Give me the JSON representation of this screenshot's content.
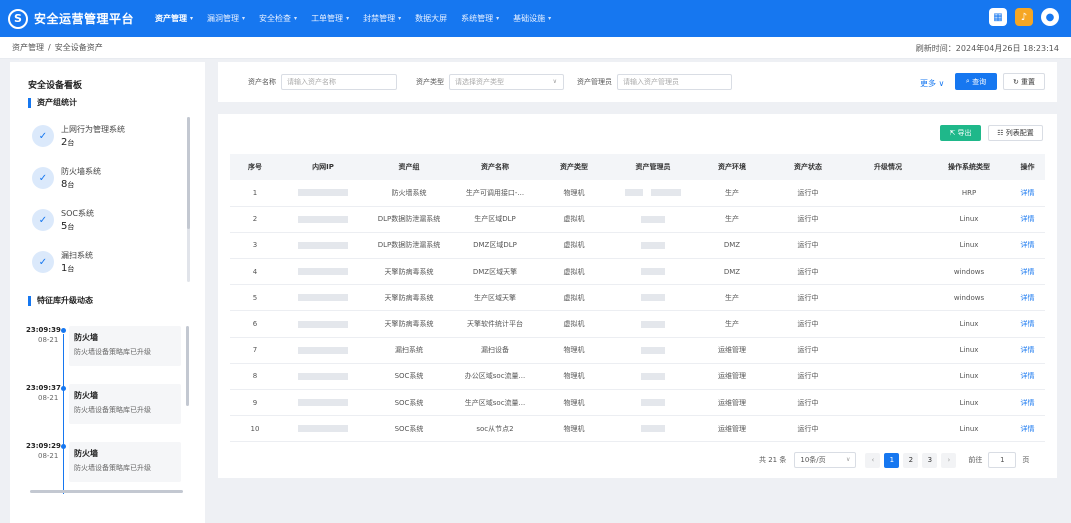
{
  "header": {
    "logo_glyph": "S",
    "title": "安全运营管理平台",
    "nav": [
      {
        "label": "资产管理",
        "caret": true,
        "active": true
      },
      {
        "label": "漏洞管理",
        "caret": true
      },
      {
        "label": "安全检查",
        "caret": true
      },
      {
        "label": "工单管理",
        "caret": true
      },
      {
        "label": "封禁管理",
        "caret": true
      },
      {
        "label": "数据大屏",
        "caret": false
      },
      {
        "label": "系统管理",
        "caret": true
      },
      {
        "label": "基础设施",
        "caret": true
      }
    ],
    "accent_color": "#1677f0"
  },
  "breadcrumb": {
    "items": [
      "资产管理",
      "安全设备资产"
    ],
    "separator": "/",
    "refresh_label": "刷新时间：",
    "refresh_time": "2024年04月26日 18:23:14"
  },
  "sidebar": {
    "title": "安全设备看板",
    "group_section": "资产组统计",
    "groups": [
      {
        "name": "上网行为管理系统",
        "count": "2",
        "unit": "台"
      },
      {
        "name": "防火墙系统",
        "count": "8",
        "unit": "台"
      },
      {
        "name": "SOC系统",
        "count": "5",
        "unit": "台"
      },
      {
        "name": "漏扫系统",
        "count": "1",
        "unit": "台"
      }
    ],
    "feed_section": "特征库升级动态",
    "feed": [
      {
        "time": "23:09:39",
        "date": "08-21",
        "title": "防火墙",
        "desc": "防火墙设备策略库已升级"
      },
      {
        "time": "23:09:37",
        "date": "08-21",
        "title": "防火墙",
        "desc": "防火墙设备策略库已升级"
      },
      {
        "time": "23:09:29",
        "date": "08-21",
        "title": "防火墙",
        "desc": "防火墙设备策略库已升级"
      }
    ]
  },
  "search": {
    "fields": [
      {
        "label": "资产名称",
        "placeholder": "请输入资产名称"
      },
      {
        "label": "资产类型",
        "placeholder": "请选择资产类型"
      },
      {
        "label": "资产管理员",
        "placeholder": "请输入资产管理员"
      }
    ],
    "more_label": "更多",
    "query_label": "查询",
    "reset_label": "重置"
  },
  "toolbar": {
    "export_label": "导出",
    "columns_label": "列表配置"
  },
  "table": {
    "columns": [
      "序号",
      "内网IP",
      "资产组",
      "资产名称",
      "资产类型",
      "资产管理员",
      "资产环境",
      "资产状态",
      "升级情况",
      "操作系统类型",
      "操作"
    ],
    "rows": [
      {
        "no": "1",
        "group": "防火墙系统",
        "name": "生产可调用接口-...",
        "type": "物理机",
        "env": "生产",
        "status": "运行中",
        "upgrade": "",
        "os": "HRP",
        "action": "详情"
      },
      {
        "no": "2",
        "group": "DLP数据防泄漏系统",
        "name": "生产区域DLP",
        "type": "虚拟机",
        "env": "生产",
        "status": "运行中",
        "upgrade": "",
        "os": "Linux",
        "action": "详情"
      },
      {
        "no": "3",
        "group": "DLP数据防泄漏系统",
        "name": "DMZ区域DLP",
        "type": "虚拟机",
        "env": "DMZ",
        "status": "运行中",
        "upgrade": "",
        "os": "Linux",
        "action": "详情"
      },
      {
        "no": "4",
        "group": "天擎防病毒系统",
        "name": "DMZ区域天擎",
        "type": "虚拟机",
        "env": "DMZ",
        "status": "运行中",
        "upgrade": "",
        "os": "windows",
        "action": "详情"
      },
      {
        "no": "5",
        "group": "天擎防病毒系统",
        "name": "生产区域天擎",
        "type": "虚拟机",
        "env": "生产",
        "status": "运行中",
        "upgrade": "",
        "os": "windows",
        "action": "详情"
      },
      {
        "no": "6",
        "group": "天擎防病毒系统",
        "name": "天擎软件统计平台",
        "type": "虚拟机",
        "env": "生产",
        "status": "运行中",
        "upgrade": "",
        "os": "Linux",
        "action": "详情"
      },
      {
        "no": "7",
        "group": "漏扫系统",
        "name": "漏扫设备",
        "type": "物理机",
        "env": "运维管理",
        "status": "运行中",
        "upgrade": "",
        "os": "Linux",
        "action": "详情"
      },
      {
        "no": "8",
        "group": "SOC系统",
        "name": "办公区域soc流量...",
        "type": "物理机",
        "env": "运维管理",
        "status": "运行中",
        "upgrade": "",
        "os": "Linux",
        "action": "详情"
      },
      {
        "no": "9",
        "group": "SOC系统",
        "name": "生产区域soc流量...",
        "type": "物理机",
        "env": "运维管理",
        "status": "运行中",
        "upgrade": "",
        "os": "Linux",
        "action": "详情"
      },
      {
        "no": "10",
        "group": "SOC系统",
        "name": "soc从节点2",
        "type": "物理机",
        "env": "运维管理",
        "status": "运行中",
        "upgrade": "",
        "os": "Linux",
        "action": "详情"
      }
    ]
  },
  "pagination": {
    "total_label": "共 21 条",
    "page_size": "10条/页",
    "pages": [
      "1",
      "2",
      "3"
    ],
    "current": "1",
    "prev": "‹",
    "next": "›",
    "goto_label": "前往",
    "goto_value": "1",
    "page_unit": "页"
  }
}
